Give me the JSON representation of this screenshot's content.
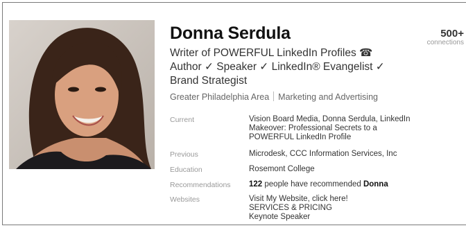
{
  "profile": {
    "name": "Donna Serdula",
    "headline_line1": "Writer of POWERFUL LinkedIn Profiles ☎",
    "headline_line2": "Author ✓ Speaker ✓ LinkedIn® Evangelist ✓",
    "headline_line3": "Brand Strategist",
    "location": "Greater Philadelphia Area",
    "industry": "Marketing and Advertising"
  },
  "connections": {
    "count": "500+",
    "label": "connections"
  },
  "details": {
    "current_label": "Current",
    "current_value": "Vision Board Media, Donna Serdula, LinkedIn Makeover: Professional Secrets to a POWERFUL LinkedIn Profile",
    "previous_label": "Previous",
    "previous_value": "Microdesk, CCC Information Services, Inc",
    "education_label": "Education",
    "education_value": "Rosemont College",
    "recommendations_label": "Recommendations",
    "recommendations_count": "122",
    "recommendations_text": " people have recommended ",
    "recommendations_name": "Donna",
    "websites_label": "Websites",
    "websites": [
      "Visit My Website, click here!",
      "SERVICES & PRICING",
      "Keynote Speaker"
    ]
  },
  "colors": {
    "name": "#111111",
    "label_gray": "#999999",
    "border": "#7a7a7a"
  },
  "icons": [
    "profile-photo",
    "phone-icon",
    "check-icon"
  ]
}
